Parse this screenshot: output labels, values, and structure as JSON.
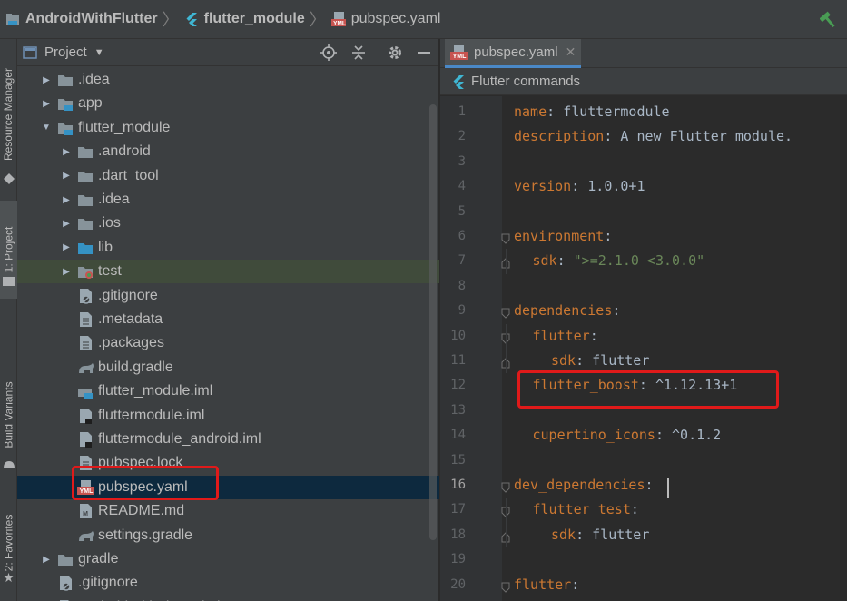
{
  "navbar": {
    "project": "AndroidWithFlutter",
    "module": "flutter_module",
    "file": "pubspec.yaml"
  },
  "stripe": {
    "resource_manager": "Resource Manager",
    "project": "1: Project",
    "build_variants": "Build Variants",
    "favorites": "2: Favorites"
  },
  "project_panel": {
    "title": "Project",
    "tree": [
      {
        "label": ".idea",
        "depth": 1,
        "arrow": "right",
        "icon": "folder-icon"
      },
      {
        "label": "app",
        "depth": 1,
        "arrow": "right",
        "icon": "module-folder-icon"
      },
      {
        "label": "flutter_module",
        "depth": 1,
        "arrow": "down",
        "icon": "module-folder-icon"
      },
      {
        "label": ".android",
        "depth": 2,
        "arrow": "right",
        "icon": "folder-icon"
      },
      {
        "label": ".dart_tool",
        "depth": 2,
        "arrow": "right",
        "icon": "folder-icon"
      },
      {
        "label": ".idea",
        "depth": 2,
        "arrow": "right",
        "icon": "folder-icon"
      },
      {
        "label": ".ios",
        "depth": 2,
        "arrow": "right",
        "icon": "folder-icon"
      },
      {
        "label": "lib",
        "depth": 2,
        "arrow": "right",
        "icon": "source-folder-icon"
      },
      {
        "label": "test",
        "depth": 2,
        "arrow": "right",
        "icon": "test-folder-icon"
      },
      {
        "label": ".gitignore",
        "depth": 2,
        "arrow": "",
        "icon": "ignore-file-icon"
      },
      {
        "label": ".metadata",
        "depth": 2,
        "arrow": "",
        "icon": "text-file-icon"
      },
      {
        "label": ".packages",
        "depth": 2,
        "arrow": "",
        "icon": "text-file-icon"
      },
      {
        "label": "build.gradle",
        "depth": 2,
        "arrow": "",
        "icon": "gradle-icon"
      },
      {
        "label": "flutter_module.iml",
        "depth": 2,
        "arrow": "",
        "icon": "module-file-icon"
      },
      {
        "label": "fluttermodule.iml",
        "depth": 2,
        "arrow": "",
        "icon": "iml-file-icon"
      },
      {
        "label": "fluttermodule_android.iml",
        "depth": 2,
        "arrow": "",
        "icon": "iml-file-icon"
      },
      {
        "label": "pubspec.lock",
        "depth": 2,
        "arrow": "",
        "icon": "text-file-icon"
      },
      {
        "label": "pubspec.yaml",
        "depth": 2,
        "arrow": "",
        "icon": "yaml-file-icon"
      },
      {
        "label": "README.md",
        "depth": 2,
        "arrow": "",
        "icon": "markdown-file-icon"
      },
      {
        "label": "settings.gradle",
        "depth": 2,
        "arrow": "",
        "icon": "gradle-icon"
      },
      {
        "label": "gradle",
        "depth": 1,
        "arrow": "right",
        "icon": "folder-icon"
      },
      {
        "label": ".gitignore",
        "depth": 1,
        "arrow": "",
        "icon": "ignore-file-icon"
      },
      {
        "label": "AndroidWithFlutter.iml",
        "depth": 1,
        "arrow": "",
        "icon": "iml-file-icon"
      }
    ]
  },
  "editor": {
    "tab_label": "pubspec.yaml",
    "tab_badge": "YML",
    "commands_label": "Flutter commands",
    "lines": [
      {
        "n": "1",
        "indent": 0,
        "key": "name",
        "sep": ": ",
        "val": "fluttermodule",
        "str": false
      },
      {
        "n": "2",
        "indent": 0,
        "key": "description",
        "sep": ": ",
        "val": "A new Flutter module.",
        "str": false
      },
      {
        "n": "3",
        "indent": 0,
        "key": "",
        "sep": "",
        "val": "",
        "str": false
      },
      {
        "n": "4",
        "indent": 0,
        "key": "version",
        "sep": ": ",
        "val": "1.0.0+1",
        "str": false
      },
      {
        "n": "5",
        "indent": 0,
        "key": "",
        "sep": "",
        "val": "",
        "str": false
      },
      {
        "n": "6",
        "indent": 0,
        "key": "environment",
        "sep": ":",
        "val": "",
        "str": false
      },
      {
        "n": "7",
        "indent": 1,
        "key": "sdk",
        "sep": ": ",
        "val": "\">=2.1.0 <3.0.0\"",
        "str": true
      },
      {
        "n": "8",
        "indent": 0,
        "key": "",
        "sep": "",
        "val": "",
        "str": false
      },
      {
        "n": "9",
        "indent": 0,
        "key": "dependencies",
        "sep": ":",
        "val": "",
        "str": false
      },
      {
        "n": "10",
        "indent": 1,
        "key": "flutter",
        "sep": ":",
        "val": "",
        "str": false
      },
      {
        "n": "11",
        "indent": 2,
        "key": "sdk",
        "sep": ": ",
        "val": "flutter",
        "str": false
      },
      {
        "n": "12",
        "indent": 1,
        "key": "flutter_boost",
        "sep": ": ",
        "val": "^1.12.13+1",
        "str": false
      },
      {
        "n": "13",
        "indent": 0,
        "key": "",
        "sep": "",
        "val": "",
        "str": false
      },
      {
        "n": "14",
        "indent": 1,
        "key": "cupertino_icons",
        "sep": ": ",
        "val": "^0.1.2",
        "str": false
      },
      {
        "n": "15",
        "indent": 0,
        "key": "",
        "sep": "",
        "val": "",
        "str": false
      },
      {
        "n": "16",
        "indent": 0,
        "key": "dev_dependencies",
        "sep": ":",
        "val": "",
        "str": false
      },
      {
        "n": "17",
        "indent": 1,
        "key": "flutter_test",
        "sep": ":",
        "val": "",
        "str": false
      },
      {
        "n": "18",
        "indent": 2,
        "key": "sdk",
        "sep": ": ",
        "val": "flutter",
        "str": false
      },
      {
        "n": "19",
        "indent": 0,
        "key": "",
        "sep": "",
        "val": "",
        "str": false
      },
      {
        "n": "20",
        "indent": 0,
        "key": "flutter",
        "sep": ":",
        "val": "",
        "str": false
      }
    ],
    "current_line": "16"
  },
  "colors": {
    "keyword": "#cc7832",
    "string": "#6a8759",
    "annotation": "#e01a1a",
    "selection": "#0d293e"
  }
}
